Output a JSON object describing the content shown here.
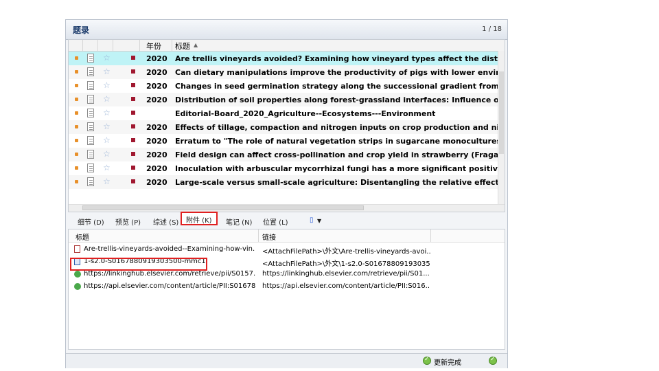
{
  "panel": {
    "title": "题录",
    "count": "1 / 18"
  },
  "grid": {
    "headers": {
      "year": "年份",
      "title": "标题",
      "sort_indicator": "▲"
    },
    "rows": [
      {
        "year": "2020",
        "title": "Are trellis vineyards avoided? Examining how vineyard types affect the distribution o"
      },
      {
        "year": "2020",
        "title": "Can dietary manipulations improve the productivity of pigs with lower environmenta"
      },
      {
        "year": "2020",
        "title": "Changes in seed germination strategy along the successional gradient from abandon"
      },
      {
        "year": "2020",
        "title": "Distribution of soil properties along forest-grassland interfaces: Influence of perman"
      },
      {
        "year": "",
        "title": "Editorial-Board_2020_Agriculture--Ecosystems---Environment"
      },
      {
        "year": "2020",
        "title": "Effects of tillage, compaction and nitrogen inputs on crop production and nitrogen lo"
      },
      {
        "year": "2020",
        "title": "Erratum to  \"The role of natural vegetation strips in sugarcane monocultures: Ant an"
      },
      {
        "year": "2020",
        "title": "Field design can affect cross-pollination and crop yield in strawberry (Fragaria x ana"
      },
      {
        "year": "2020",
        "title": "Inoculation with arbuscular mycorrhizal fungi has a more significant positive impact"
      },
      {
        "year": "2020",
        "title": "Large-scale versus small-scale agriculture: Disentangling the relative effects of the fa"
      }
    ]
  },
  "tabs": {
    "details": "细节 (D)",
    "preview": "预览 (P)",
    "summary": "综述 (S)",
    "attachments": "附件 (K)",
    "notes": "笔记 (N)",
    "location": "位置 (L)",
    "clip": "▼"
  },
  "attachments": {
    "headers": {
      "title": "标题",
      "link": "链接"
    },
    "rows": [
      {
        "title": "Are-trellis-vineyards-avoided--Examining-how-vin...",
        "link": "<AttachFilePath>\\外文\\Are-trellis-vineyards-avoi..."
      },
      {
        "title": "1-s2.0-S0167880919303500-mmc1",
        "link": "<AttachFilePath>\\外文\\1-s2.0-S01678809193035..."
      },
      {
        "title": "https://linkinghub.elsevier.com/retrieve/pii/S0157...",
        "link": "https://linkinghub.elsevier.com/retrieve/pii/S01..."
      },
      {
        "title": "https://api.elsevier.com/content/article/PII:S01678...",
        "link": "https://api.elsevier.com/content/article/PII:S016..."
      }
    ]
  },
  "status": {
    "text": "更新完成"
  }
}
